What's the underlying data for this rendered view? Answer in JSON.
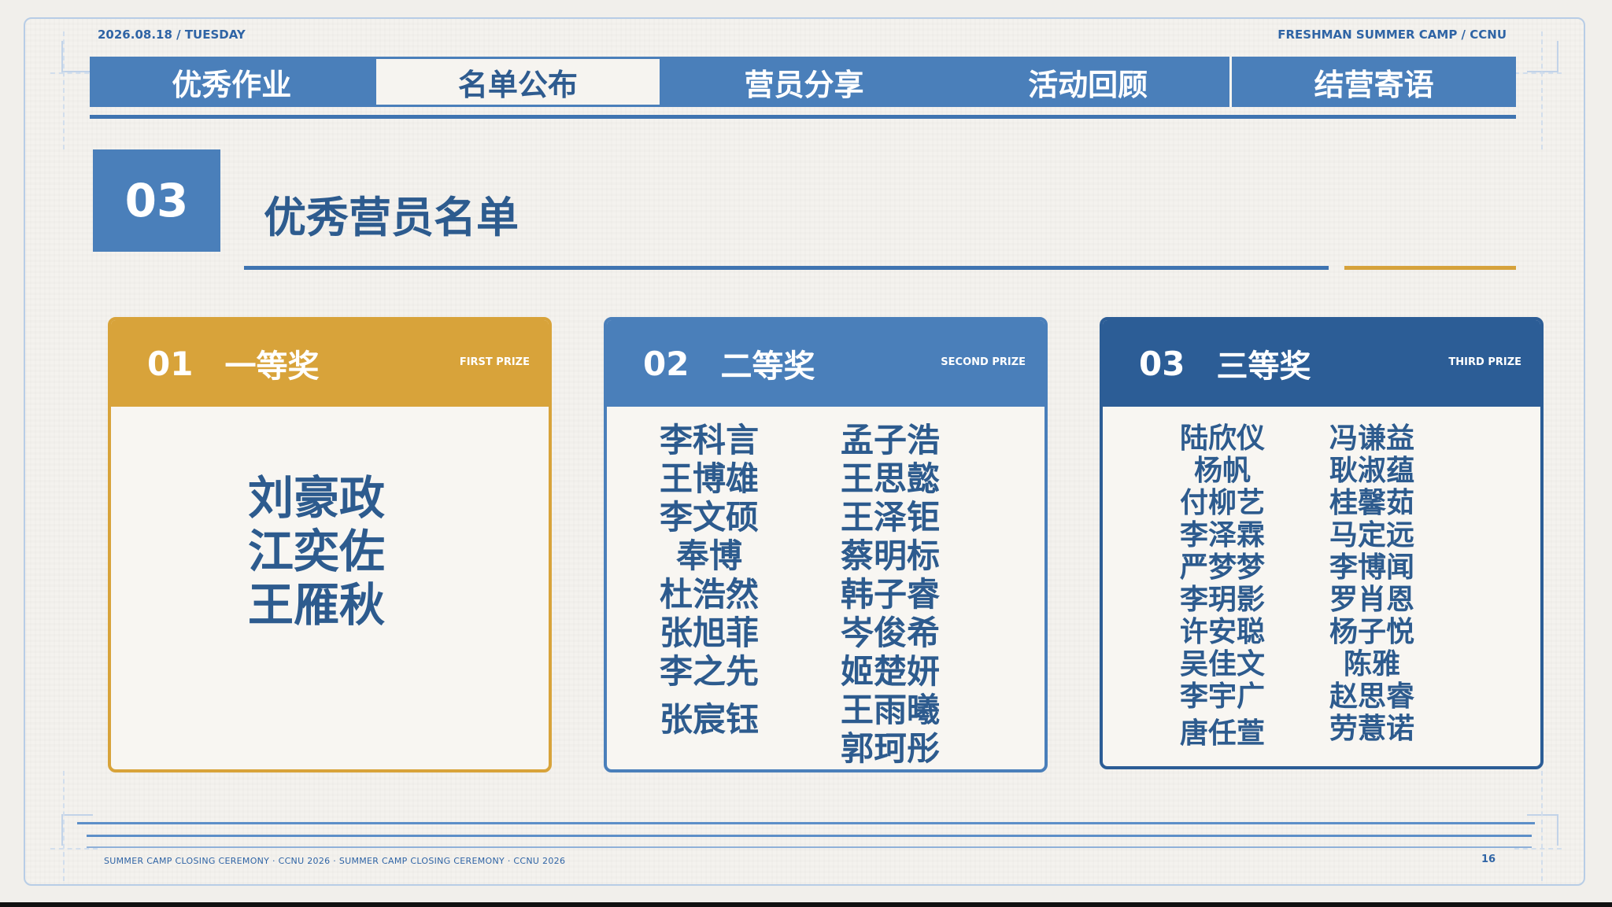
{
  "header": {
    "date": "2026.08.18 / TUESDAY",
    "brand": "FRESHMAN SUMMER CAMP / CCNU"
  },
  "nav": {
    "tabs": [
      {
        "label": "优秀作业"
      },
      {
        "label": "名单公布",
        "active": true
      },
      {
        "label": "营员分享"
      },
      {
        "label": "活动回顾"
      },
      {
        "label": "结营寄语"
      }
    ]
  },
  "section": {
    "number": "03",
    "title": "优秀营员名单"
  },
  "cards": [
    {
      "num": "01",
      "title": "一等奖",
      "en": "FIRST PRIZE",
      "color": "#d8a33a",
      "names": [
        "刘豪政",
        "江奕佐",
        "王雁秋"
      ]
    },
    {
      "num": "02",
      "title": "二等奖",
      "en": "SECOND PRIZE",
      "color": "#4a7fba",
      "col1": [
        "李科言",
        "王博雄",
        "李文硕",
        "奉博",
        "杜浩然",
        "张旭菲",
        "李之先",
        "张宸钰"
      ],
      "col2": [
        "孟子浩",
        "王思懿",
        "王泽钜",
        "蔡明标",
        "韩子睿",
        "岑俊希",
        "姬楚妍",
        "王雨曦",
        "郭珂彤"
      ]
    },
    {
      "num": "03",
      "title": "三等奖",
      "en": "THIRD PRIZE",
      "color": "#2c5d96",
      "col1": [
        "陆欣仪",
        "杨帆",
        "付柳艺",
        "李泽霖",
        "严梦梦",
        "李玥影",
        "许安聪",
        "吴佳文",
        "李宇广",
        "唐任萱"
      ],
      "col2": [
        "冯谦益",
        "耿淑蕴",
        "桂馨茹",
        "马定远",
        "李博闻",
        "罗肖恩",
        "杨子悦",
        "陈雅",
        "赵思睿",
        "劳薏诺"
      ]
    }
  ],
  "footer": {
    "text": "SUMMER CAMP CLOSING CEREMONY · CCNU 2026 · SUMMER CAMP CLOSING CEREMONY · CCNU 2026",
    "page": "16"
  }
}
